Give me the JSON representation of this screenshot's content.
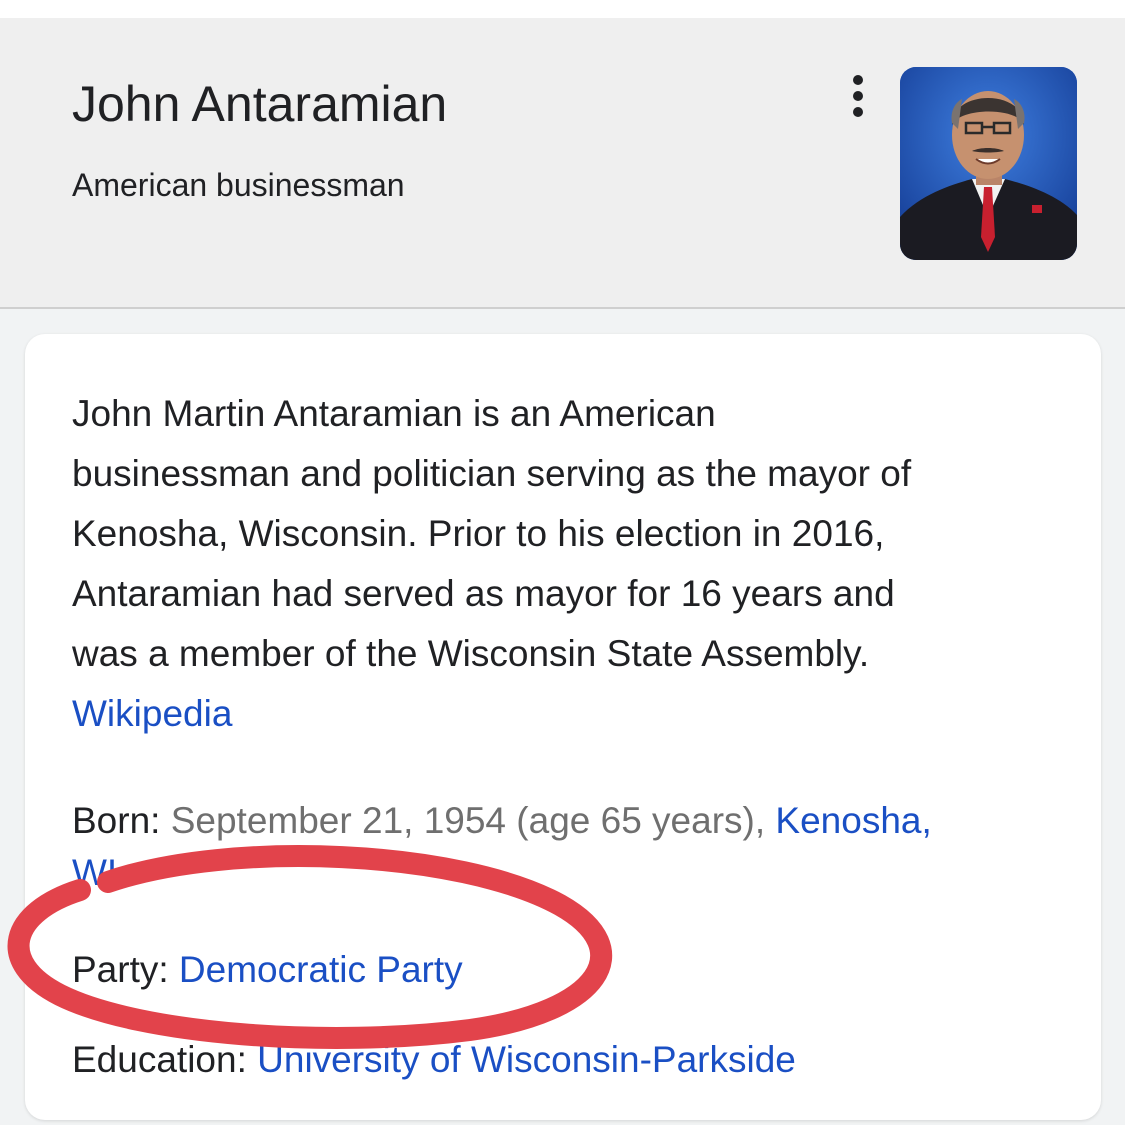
{
  "header": {
    "title": "John Antaramian",
    "subtitle": "American businessman"
  },
  "icons": {
    "more": "more-vert-icon"
  },
  "description": {
    "text": "John Martin Antaramian is an American\nbusinessman and politician serving as the mayor of\nKenosha, Wisconsin. Prior to his election in 2016,\nAntaramian had served as mayor for 16 years and\nwas a member of the Wisconsin State Assembly.",
    "source_link": "Wikipedia"
  },
  "facts": {
    "born": {
      "label": "Born:",
      "value": "September 21, 1954 (age 65 years),",
      "place_link_line1": "Kenosha,",
      "place_link_line2": "WI"
    },
    "party": {
      "label": "Party:",
      "value_link": "Democratic Party"
    },
    "education": {
      "label": "Education:",
      "value_link": "University of Wisconsin-Parkside"
    }
  },
  "colors": {
    "link": "#1a4fc4",
    "annotation_circle": "#e2434b",
    "header_bg": "#efefef"
  }
}
